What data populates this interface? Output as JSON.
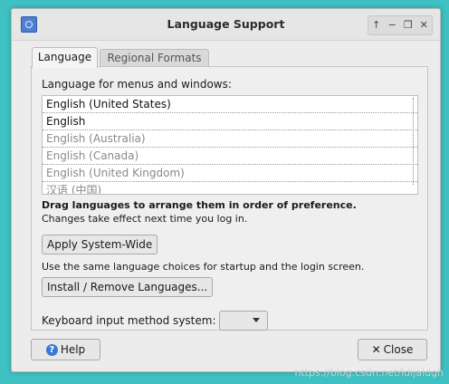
{
  "window": {
    "title": "Language Support",
    "controls": [
      "↑",
      "−",
      "❐",
      "✕"
    ]
  },
  "tabs": [
    {
      "label": "Language",
      "active": true
    },
    {
      "label": "Regional Formats",
      "active": false
    }
  ],
  "language": {
    "section_label": "Language for menus and windows:",
    "list": [
      {
        "label": "English (United States)",
        "enabled": true
      },
      {
        "label": "English",
        "enabled": true
      },
      {
        "label": "English (Australia)",
        "enabled": false
      },
      {
        "label": "English (Canada)",
        "enabled": false
      },
      {
        "label": "English (United Kingdom)",
        "enabled": false
      },
      {
        "label": "汉语 (中国)",
        "enabled": false
      }
    ],
    "drag_hint": "Drag languages to arrange them in order of preference.",
    "changes_hint": "Changes take effect next time you log in.",
    "apply_button": "Apply System-Wide",
    "apply_desc": "Use the same language choices for startup and the login screen.",
    "install_button": "Install / Remove Languages...",
    "keyboard_label": "Keyboard input method system:",
    "keyboard_value": ""
  },
  "footer": {
    "help_label": "Help",
    "close_label": "Close"
  },
  "watermark": "https://blog.csdn.net/ldijaldgh",
  "colors": {
    "desktop": "#3fc1c4",
    "window_bg": "#ececec",
    "help_icon": "#3a78d6"
  }
}
